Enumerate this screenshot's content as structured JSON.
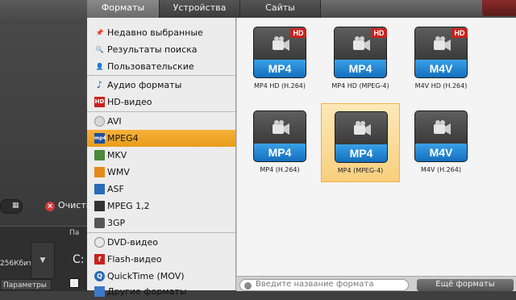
{
  "background": {
    "clear_label": "Очистить",
    "bitrate": "256Кбит",
    "params_label": "Параметры",
    "partial_label": "Па",
    "drive_letter": "C:"
  },
  "tabs": [
    {
      "label": "Форматы",
      "active": true
    },
    {
      "label": "Устройства",
      "active": false
    },
    {
      "label": "Сайты",
      "active": false
    }
  ],
  "sidebar": {
    "items": [
      {
        "label": "Недавно выбранные",
        "icon": "pin-icon"
      },
      {
        "label": "Результаты поиска",
        "icon": "magnifier-icon"
      },
      {
        "label": "Пользовательские",
        "icon": "user-icon"
      },
      {
        "label": "Аудио форматы",
        "icon": "music-note-icon"
      },
      {
        "label": "HD-видео",
        "icon": "hd-icon"
      },
      {
        "label": "AVI",
        "icon": "disc-icon"
      },
      {
        "label": "MPEG4",
        "icon": "mp4-icon",
        "selected": true
      },
      {
        "label": "MKV",
        "icon": "mkv-icon"
      },
      {
        "label": "WMV",
        "icon": "wmv-icon"
      },
      {
        "label": "ASF",
        "icon": "asf-icon"
      },
      {
        "label": "MPEG 1,2",
        "icon": "mpeg-icon"
      },
      {
        "label": "3GP",
        "icon": "3gp-icon"
      },
      {
        "label": "DVD-видео",
        "icon": "dvd-icon"
      },
      {
        "label": "Flash-видео",
        "icon": "flash-icon"
      },
      {
        "label": "QuickTime (MOV)",
        "icon": "quicktime-icon"
      },
      {
        "label": "Другие форматы",
        "icon": "folder-icon"
      }
    ]
  },
  "formats": [
    {
      "badge": "MP4",
      "hd": "HD",
      "caption": "MP4 HD (H.264)"
    },
    {
      "badge": "MP4",
      "hd": "HD",
      "caption": "MP4 HD (MPEG-4)"
    },
    {
      "badge": "M4V",
      "hd": "HD",
      "caption": "M4V HD (H.264)"
    },
    {
      "badge": "MP4",
      "hd": "",
      "caption": "MP4 (H.264)"
    },
    {
      "badge": "MP4",
      "hd": "",
      "caption": "MP4 (MPEG-4)",
      "selected": true
    },
    {
      "badge": "M4V",
      "hd": "",
      "caption": "M4V (H.264)"
    }
  ],
  "search": {
    "placeholder": "Введите название формата",
    "button_label": "Ещё форматы"
  },
  "colors": {
    "selection": "#f0a830",
    "badge_blue": "#1f85d1",
    "hd_red": "#c8231f"
  }
}
